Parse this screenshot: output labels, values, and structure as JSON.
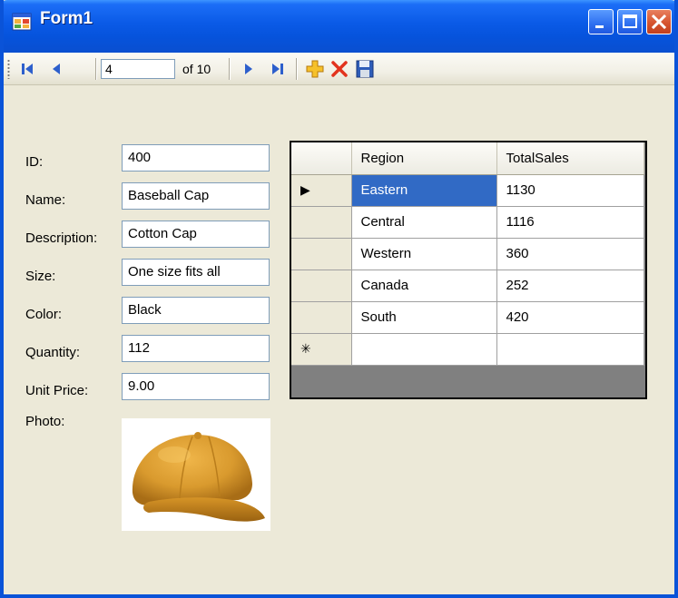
{
  "window": {
    "title": "Form1",
    "colors": {
      "titlebar": "#0a5ae6",
      "face": "#ece9d8",
      "selection": "#316ac5"
    }
  },
  "title_buttons": {
    "minimize_icon": "minimize-icon",
    "maximize_icon": "maximize-icon",
    "close_icon": "close-icon"
  },
  "navigator": {
    "position": "4",
    "of_label": "of 10",
    "icons": [
      "move-first-icon",
      "move-previous-icon",
      "move-next-icon",
      "move-last-icon",
      "add-new-icon",
      "delete-icon",
      "save-icon"
    ]
  },
  "form": {
    "fields": [
      {
        "label": "ID:",
        "value": "400"
      },
      {
        "label": "Name:",
        "value": "Baseball Cap"
      },
      {
        "label": "Description:",
        "value": "Cotton Cap"
      },
      {
        "label": "Size:",
        "value": "One size fits all"
      },
      {
        "label": "Color:",
        "value": "Black"
      },
      {
        "label": "Quantity:",
        "value": "112"
      },
      {
        "label": "Unit Price:",
        "value": "9.00"
      }
    ],
    "photo_label": "Photo:",
    "photo_icon": "baseball-cap-photo"
  },
  "grid": {
    "columns": [
      "Region",
      "TotalSales"
    ],
    "rows": [
      {
        "region": "Eastern",
        "total_sales": "1130"
      },
      {
        "region": "Central",
        "total_sales": "1116"
      },
      {
        "region": "Western",
        "total_sales": "360"
      },
      {
        "region": "Canada",
        "total_sales": "252"
      },
      {
        "region": "South",
        "total_sales": "420"
      }
    ],
    "current_row_marker": "▶",
    "new_row_marker": "✳"
  }
}
